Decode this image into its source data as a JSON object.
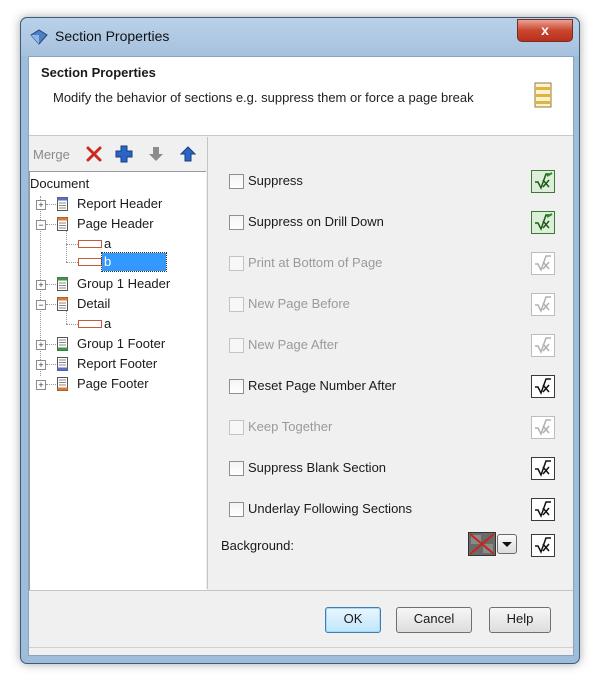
{
  "window": {
    "title": "Section Properties",
    "close_label": "x"
  },
  "header": {
    "title": "Section Properties",
    "description": "Modify the behavior of sections e.g. suppress them or force a page break"
  },
  "toolbar": {
    "merge_label": "Merge",
    "icons": [
      "delete-icon",
      "add-icon",
      "move-down-icon",
      "move-up-icon"
    ]
  },
  "tree": {
    "root_label": "Document",
    "items": [
      {
        "label": "Report Header"
      },
      {
        "label": "Page Header"
      },
      {
        "label": "a"
      },
      {
        "label": "b"
      },
      {
        "label": "Group 1 Header"
      },
      {
        "label": "Detail"
      },
      {
        "label": "a"
      },
      {
        "label": "Group 1 Footer"
      },
      {
        "label": "Report Footer"
      },
      {
        "label": "Page Footer"
      }
    ]
  },
  "options": [
    {
      "label": "Suppress",
      "enabled": true,
      "checked": false,
      "formula": "set"
    },
    {
      "label": "Suppress on Drill Down",
      "enabled": true,
      "checked": false,
      "formula": "set"
    },
    {
      "label": "Print at Bottom of Page",
      "enabled": false,
      "checked": false,
      "formula": "disabled"
    },
    {
      "label": "New Page Before",
      "enabled": false,
      "checked": false,
      "formula": "disabled"
    },
    {
      "label": "New Page After",
      "enabled": false,
      "checked": false,
      "formula": "disabled"
    },
    {
      "label": "Reset Page Number After",
      "enabled": true,
      "checked": false,
      "formula": "empty"
    },
    {
      "label": "Keep Together",
      "enabled": false,
      "checked": false,
      "formula": "disabled"
    },
    {
      "label": "Suppress Blank Section",
      "enabled": true,
      "checked": false,
      "formula": "empty"
    },
    {
      "label": "Underlay Following Sections",
      "enabled": true,
      "checked": false,
      "formula": "empty"
    }
  ],
  "background": {
    "label": "Background:",
    "swatch": "no-color"
  },
  "buttons": {
    "ok": "OK",
    "cancel": "Cancel",
    "help": "Help"
  },
  "colors": {
    "selection": "#3399ff",
    "formula_set": "#3c7a34",
    "delete_icon": "#cc2a1f",
    "add_icon": "#2a64c4"
  }
}
